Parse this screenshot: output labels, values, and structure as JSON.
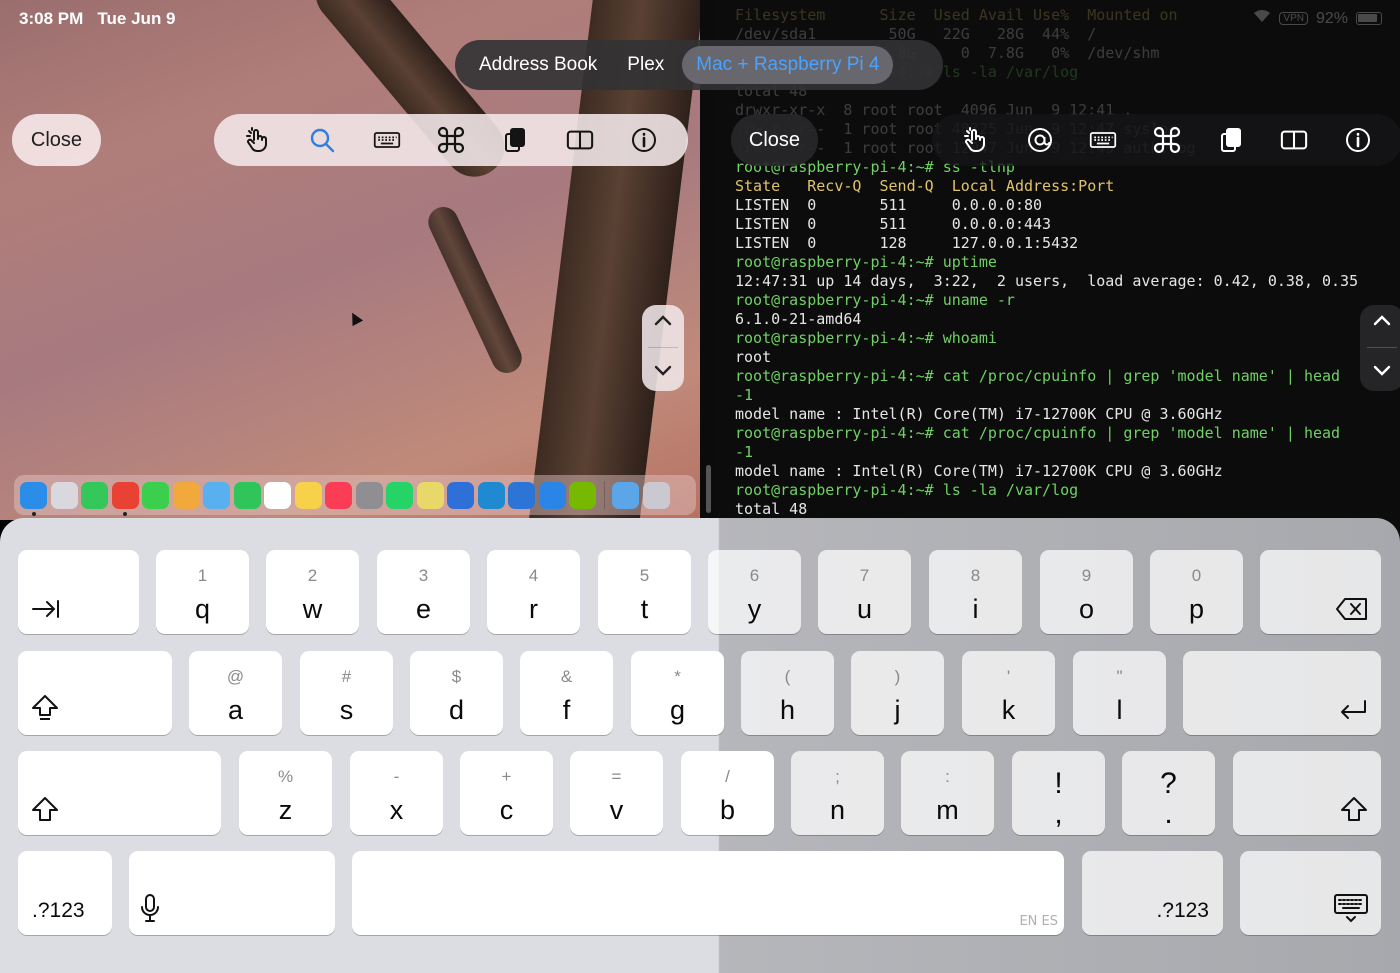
{
  "status_bar": {
    "time": "3:08 PM",
    "date": "Tue Jun 9",
    "vpn": "VPN",
    "battery": "92%"
  },
  "tabs": [
    {
      "label": "Address Book",
      "active": false
    },
    {
      "label": "Plex",
      "active": false
    },
    {
      "label": "Mac + Raspberry Pi 4",
      "active": true
    }
  ],
  "left_session": {
    "close_label": "Close"
  },
  "right_session": {
    "close_label": "Close"
  },
  "toolbar_left_icons": [
    "touch-icon",
    "search-icon",
    "keyboard-icon",
    "command-icon",
    "clipboard-icon",
    "split-view-icon",
    "info-icon"
  ],
  "toolbar_right_icons": [
    "touch-icon",
    "at-sign-icon",
    "keyboard-icon",
    "command-icon",
    "clipboard-icon",
    "split-view-icon",
    "info-icon"
  ],
  "dock_apps": [
    {
      "name": "finder",
      "color": "#2a8de8",
      "running": true
    },
    {
      "name": "launchpad",
      "color": "#d8d8de"
    },
    {
      "name": "phone",
      "color": "#34c759"
    },
    {
      "name": "chrome",
      "color": "#e94235",
      "running": true
    },
    {
      "name": "messages",
      "color": "#3ccf4e"
    },
    {
      "name": "photos",
      "color": "#f2a93b"
    },
    {
      "name": "maps",
      "color": "#58b0f0"
    },
    {
      "name": "facetime",
      "color": "#30c55a"
    },
    {
      "name": "calendar",
      "color": "#ffffff"
    },
    {
      "name": "notes",
      "color": "#f7d14a"
    },
    {
      "name": "music",
      "color": "#fa3c55"
    },
    {
      "name": "settings",
      "color": "#8e8e93"
    },
    {
      "name": "whatsapp",
      "color": "#25d366"
    },
    {
      "name": "stickies",
      "color": "#e8d86a"
    },
    {
      "name": "preview",
      "color": "#2f6fd8"
    },
    {
      "name": "vscode",
      "color": "#1f8ad2"
    },
    {
      "name": "xcode",
      "color": "#2c74d6"
    },
    {
      "name": "remote-desktop",
      "color": "#2a85e6"
    },
    {
      "name": "nvidia",
      "color": "#76b900"
    }
  ],
  "dock_extras": [
    {
      "name": "downloads-folder",
      "color": "#5aa6e8"
    },
    {
      "name": "trash",
      "color": "#c9c9cf"
    }
  ],
  "terminal_lines": [
    {
      "text": "Filesystem      Size  Used Avail Use%  Mounted on",
      "cls": "hdr dim"
    },
    {
      "text": "/dev/sda1        50G   22G   28G  44%  /",
      "cls": "dim"
    },
    {
      "text": "tmpfs           7.8G     0  7.8G   0%  /dev/shm",
      "cls": "dim"
    },
    {
      "text": "root@raspberry-pi-4:~# ls -la /var/log",
      "cls": "prompt dim"
    },
    {
      "text": "total 48",
      "cls": "dim"
    },
    {
      "text": "drwxr-xr-x  8 root root  4096 Jun  9 12:41 .",
      "cls": "dim"
    },
    {
      "text": "-rw-r--r--  1 root root 48325 Jun  9 12:47 syslog",
      "cls": "dim"
    },
    {
      "text": "-rw-r--r--  1 root root 12047 Jun  9 12:45 auth.log",
      "cls": "dim"
    },
    {
      "text": "root@raspberry-pi-4:~# ss -tlnp",
      "cls": "prompt"
    },
    {
      "text": "State   Recv-Q  Send-Q  Local Address:Port",
      "cls": "hdr"
    },
    {
      "text": "LISTEN  0       511     0.0.0.0:80",
      "cls": ""
    },
    {
      "text": "LISTEN  0       511     0.0.0.0:443",
      "cls": ""
    },
    {
      "text": "LISTEN  0       128     127.0.0.1:5432",
      "cls": ""
    },
    {
      "text": "root@raspberry-pi-4:~# uptime",
      "cls": "prompt"
    },
    {
      "text": "12:47:31 up 14 days,  3:22,  2 users,  load average: 0.42, 0.38, 0.35",
      "cls": ""
    },
    {
      "text": "root@raspberry-pi-4:~# uname -r",
      "cls": "prompt"
    },
    {
      "text": "6.1.0-21-amd64",
      "cls": ""
    },
    {
      "text": "root@raspberry-pi-4:~# whoami",
      "cls": "prompt"
    },
    {
      "text": "root",
      "cls": ""
    },
    {
      "text": "root@raspberry-pi-4:~# cat /proc/cpuinfo | grep 'model name' | head",
      "cls": "prompt"
    },
    {
      "text": "-1",
      "cls": "prompt"
    },
    {
      "text": "model name : Intel(R) Core(TM) i7-12700K CPU @ 3.60GHz",
      "cls": ""
    },
    {
      "text": "root@raspberry-pi-4:~# cat /proc/cpuinfo | grep 'model name' | head",
      "cls": "prompt"
    },
    {
      "text": "-1",
      "cls": "prompt"
    },
    {
      "text": "model name : Intel(R) Core(TM) i7-12700K CPU @ 3.60GHz",
      "cls": ""
    },
    {
      "text": "root@raspberry-pi-4:~# ls -la /var/log",
      "cls": "prompt"
    },
    {
      "text": "total 48",
      "cls": ""
    }
  ],
  "keyboard": {
    "rows": [
      [
        {
          "type": "tab"
        },
        {
          "main": "q",
          "sub": "1"
        },
        {
          "main": "w",
          "sub": "2"
        },
        {
          "main": "e",
          "sub": "3"
        },
        {
          "main": "r",
          "sub": "4"
        },
        {
          "main": "t",
          "sub": "5"
        },
        {
          "main": "y",
          "sub": "6"
        },
        {
          "main": "u",
          "sub": "7"
        },
        {
          "main": "i",
          "sub": "8"
        },
        {
          "main": "o",
          "sub": "9"
        },
        {
          "main": "p",
          "sub": "0"
        },
        {
          "type": "delete"
        }
      ],
      [
        {
          "type": "capslock"
        },
        {
          "main": "a",
          "sub": "@"
        },
        {
          "main": "s",
          "sub": "#"
        },
        {
          "main": "d",
          "sub": "$"
        },
        {
          "main": "f",
          "sub": "&"
        },
        {
          "main": "g",
          "sub": "*"
        },
        {
          "main": "h",
          "sub": "("
        },
        {
          "main": "j",
          "sub": ")"
        },
        {
          "main": "k",
          "sub": "'"
        },
        {
          "main": "l",
          "sub": "\""
        },
        {
          "type": "return"
        }
      ],
      [
        {
          "type": "shift"
        },
        {
          "main": "z",
          "sub": "%"
        },
        {
          "main": "x",
          "sub": "-"
        },
        {
          "main": "c",
          "sub": "+"
        },
        {
          "main": "v",
          "sub": "="
        },
        {
          "main": "b",
          "sub": "/"
        },
        {
          "main": "n",
          "sub": ";"
        },
        {
          "main": "m",
          "sub": ":"
        },
        {
          "punct_main": "!",
          "punct_sub": ","
        },
        {
          "punct_main": "?",
          "punct_sub": "."
        },
        {
          "type": "shift"
        }
      ],
      [
        {
          "type": "numbers",
          "label": ".?123"
        },
        {
          "type": "mic"
        },
        {
          "type": "space",
          "tag": "EN ES"
        },
        {
          "type": "numbers",
          "label": ".?123"
        },
        {
          "type": "hide-keyboard"
        }
      ]
    ]
  }
}
